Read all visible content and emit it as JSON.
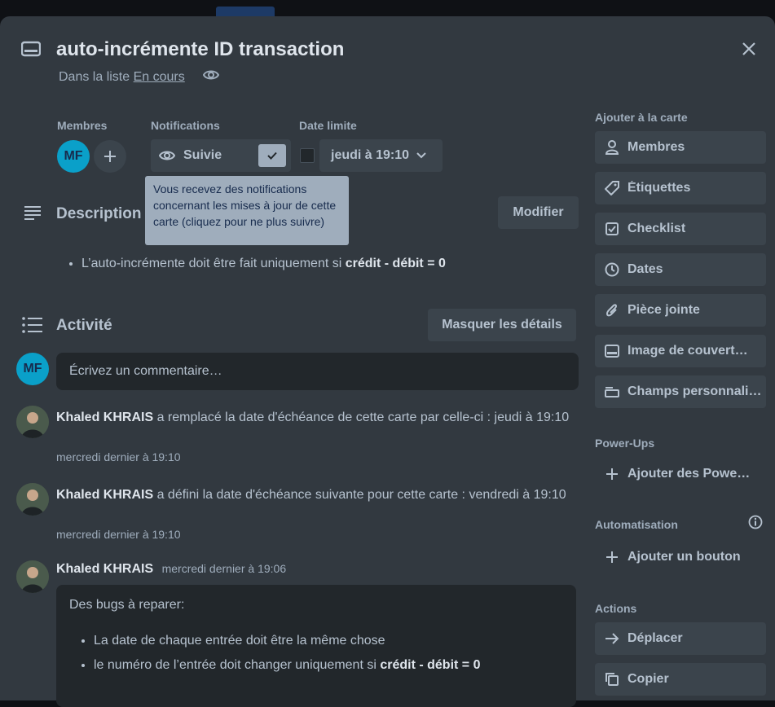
{
  "card": {
    "title": "auto-incrémente ID transaction",
    "list_prefix": "Dans la liste",
    "list_name": "En cours"
  },
  "members_label": "Membres",
  "member_initials": "MF",
  "notifications": {
    "label": "Notifications",
    "button": "Suivie"
  },
  "due": {
    "label": "Date limite",
    "value": "jeudi à 19:10"
  },
  "tooltip": "Vous recevez des notifications concernant les mises à jour de cette carte (cliquez pour ne plus suivre)",
  "description": {
    "title": "Description",
    "edit_button": "Modifier",
    "item_text": "L’auto-incrémente doit être fait uniquement si",
    "item_bold": "crédit - débit = 0"
  },
  "activity": {
    "title": "Activité",
    "hide_button": "Masquer les détails",
    "comment_placeholder": "Écrivez un commentaire…",
    "entries": [
      {
        "author": "Khaled KHRAIS",
        "text": "a remplacé la date d'échéance de cette carte par celle-ci : jeudi à 19:10",
        "time": "mercredi dernier à 19:10"
      },
      {
        "author": "Khaled KHRAIS",
        "text": "a défini la date d'échéance suivante pour cette carte : vendredi à 19:10",
        "time": "mercredi dernier à 19:10"
      }
    ],
    "comment": {
      "author": "Khaled KHRAIS",
      "time": "mercredi dernier à 19:06",
      "heading": "Des bugs à reparer:",
      "item1": "La date de chaque entrée doit être la même chose",
      "item2_text": "le numéro de l’entrée doit changer uniquement si",
      "item2_bold": "crédit - débit = 0"
    }
  },
  "sidebar": {
    "add_label": "Ajouter à la carte",
    "add_items": [
      "Membres",
      "Étiquettes",
      "Checklist",
      "Dates",
      "Pièce jointe",
      "Image de couvert…",
      "Champs personnali…"
    ],
    "powerups_label": "Power-Ups",
    "powerups_button": "Ajouter des Powe…",
    "automation_label": "Automatisation",
    "automation_button": "Ajouter un bouton",
    "actions_label": "Actions",
    "actions_items": [
      "Déplacer",
      "Copier"
    ]
  },
  "colors": {
    "modal_bg": "#323940",
    "avatar_bg": "#0aa0c9",
    "tooltip_bg": "#9fadbc"
  }
}
